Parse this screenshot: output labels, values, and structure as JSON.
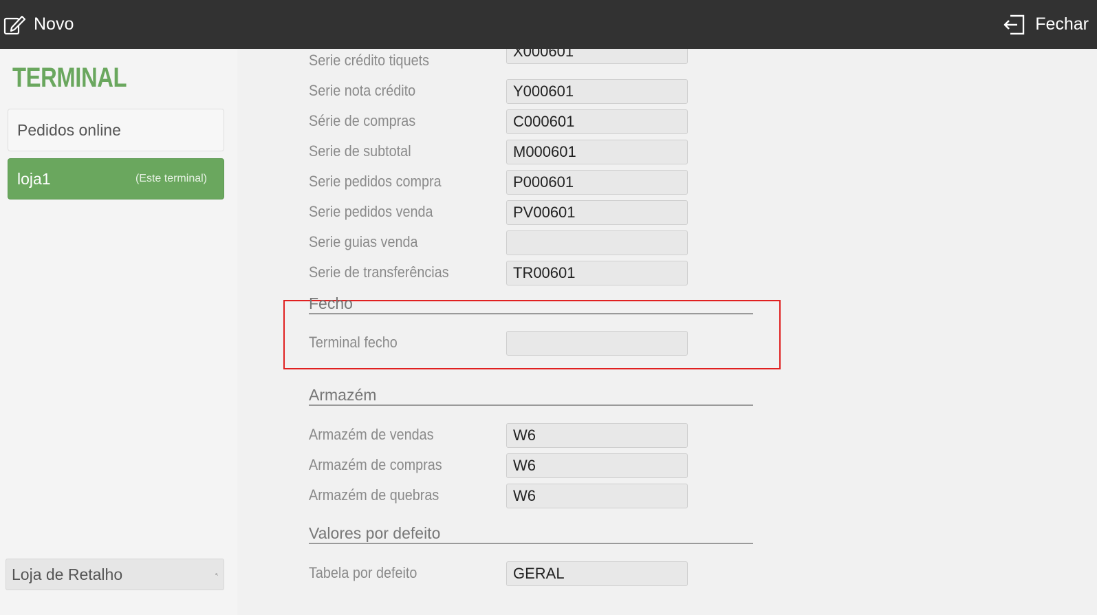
{
  "topbar": {
    "new_label": "Novo",
    "close_label": "Fechar",
    "new_icon": "edit-icon",
    "close_icon": "exit-icon"
  },
  "sidebar": {
    "title": "TERMINAL",
    "items": [
      {
        "label": "Pedidos online"
      },
      {
        "label": "loja1",
        "sub": "(Este terminal)"
      }
    ],
    "search": {
      "value": "Loja de Retalho",
      "icon": "search-icon"
    },
    "accent_color": "#6aa75e"
  },
  "series_rows": [
    {
      "label": "Serie crédito tiquets",
      "value": "X000601"
    },
    {
      "label": "Serie nota crédito",
      "value": "Y000601"
    },
    {
      "label": "Série de compras",
      "value": "C000601"
    },
    {
      "label": "Serie de subtotal",
      "value": "M000601"
    },
    {
      "label": "Serie pedidos compra",
      "value": "P000601"
    },
    {
      "label": "Serie pedidos venda",
      "value": "PV00601"
    },
    {
      "label": "Serie guias venda",
      "value": ""
    },
    {
      "label": "Serie de transferências",
      "value": "TR00601"
    }
  ],
  "fecho": {
    "title": "Fecho",
    "rows": [
      {
        "label": "Terminal fecho",
        "value": ""
      }
    ],
    "highlight_color": "#e02020"
  },
  "armazem": {
    "title": "Armazém",
    "rows": [
      {
        "label": "Armazém de vendas",
        "value": "W6"
      },
      {
        "label": "Armazém de compras",
        "value": "W6"
      },
      {
        "label": "Armazém de quebras",
        "value": "W6"
      }
    ]
  },
  "defaults": {
    "title": "Valores por defeito",
    "rows": [
      {
        "label": "Tabela por defeito",
        "value": "GERAL"
      }
    ]
  }
}
